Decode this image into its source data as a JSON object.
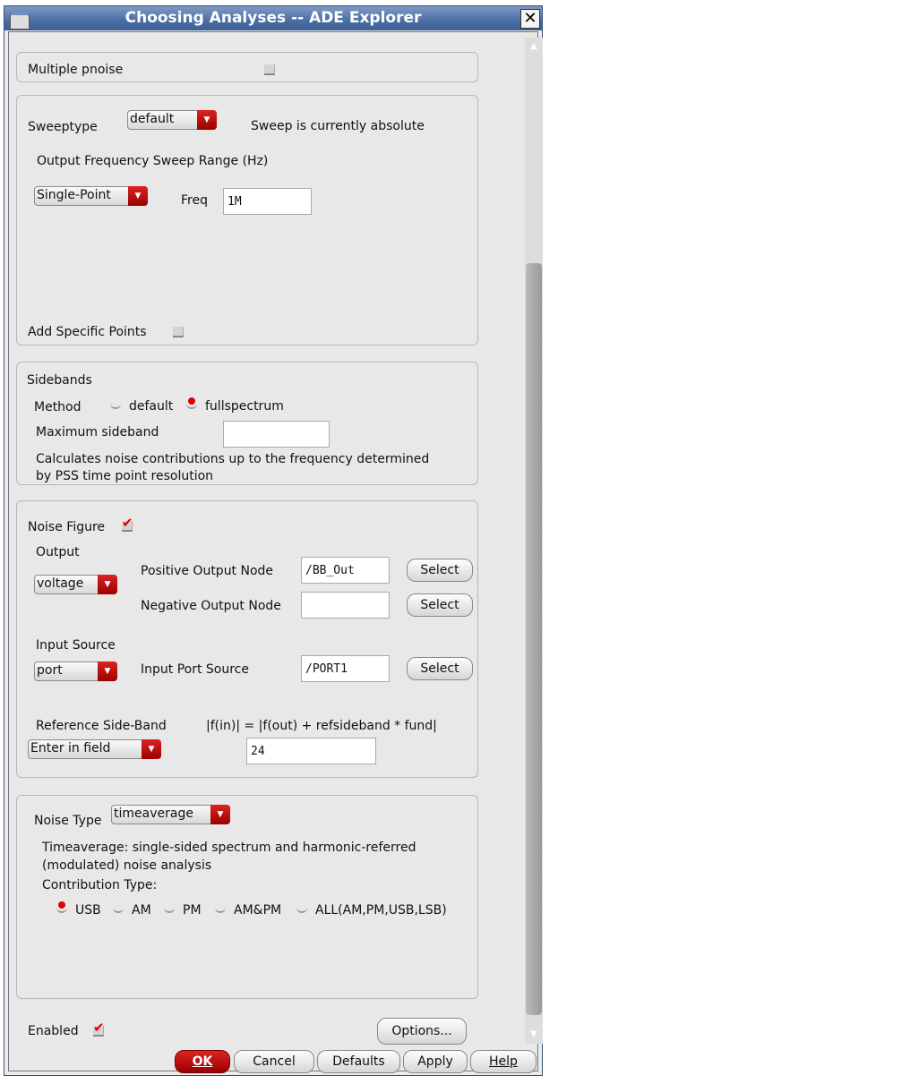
{
  "window": {
    "title": "Choosing Analyses -- ADE Explorer",
    "close": "✕"
  },
  "multiple_pnoise": {
    "label": "Multiple pnoise",
    "checked": false
  },
  "sweep": {
    "sweeptype_label": "Sweeptype",
    "sweeptype_value": "default",
    "status": "Sweep is currently absolute",
    "range_label": "Output Frequency Sweep Range (Hz)",
    "range_value": "Single-Point",
    "freq_label": "Freq",
    "freq_value": "1M",
    "add_points_label": "Add Specific Points",
    "add_points_checked": false
  },
  "sidebands": {
    "title": "Sidebands",
    "method_label": "Method",
    "methods": [
      "default",
      "fullspectrum"
    ],
    "selected": "fullspectrum",
    "max_label": "Maximum sideband",
    "max_value": "",
    "note1": "Calculates noise contributions up to the frequency determined",
    "note2": "by PSS time point resolution"
  },
  "noise_figure": {
    "label": "Noise Figure",
    "checked": true,
    "output_label": "Output",
    "output_value": "voltage",
    "pos_label": "Positive Output Node",
    "pos_value": "/BB_Out",
    "neg_label": "Negative Output Node",
    "neg_value": "",
    "select": "Select",
    "input_label": "Input Source",
    "input_value": "port",
    "port_label": "Input Port Source",
    "port_value": "/PORT1",
    "ref_label": "Reference Side-Band",
    "ref_formula": "|f(in)| = |f(out) + refsideband * fund|",
    "ref_mode": "Enter in field",
    "ref_value": "24"
  },
  "noise_type": {
    "label": "Noise Type",
    "value": "timeaverage",
    "desc1": "Timeaverage: single-sided spectrum and harmonic-referred",
    "desc2": "(modulated) noise analysis",
    "contrib_label": "Contribution Type:",
    "options": [
      "USB",
      "AM",
      "PM",
      "AM&PM",
      "ALL(AM,PM,USB,LSB)"
    ],
    "selected": "USB"
  },
  "footer": {
    "enabled_label": "Enabled",
    "enabled": true,
    "options": "Options...",
    "ok": "OK",
    "cancel": "Cancel",
    "defaults": "Defaults",
    "apply": "Apply",
    "help": "Help"
  }
}
